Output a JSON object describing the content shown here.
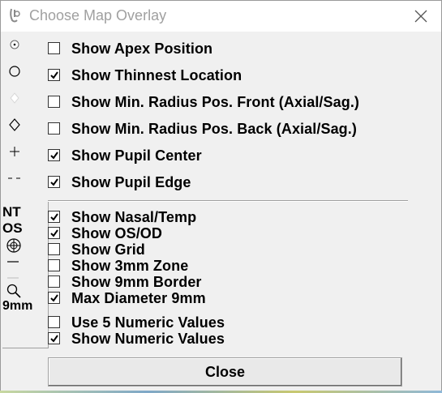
{
  "window": {
    "title": "Choose Map Overlay"
  },
  "groups": {
    "main": [
      {
        "label": "Show Apex Position",
        "checked": false,
        "icon": "dot-circle-icon"
      },
      {
        "label": "Show Thinnest Location",
        "checked": true,
        "icon": "circle-icon"
      },
      {
        "label": "Show Min. Radius Pos. Front (Axial/Sag.)",
        "checked": false,
        "icon": "filled-diamond-icon"
      },
      {
        "label": "Show Min. Radius Pos. Back (Axial/Sag.)",
        "checked": false,
        "icon": "diamond-icon"
      },
      {
        "label": "Show Pupil Center",
        "checked": true,
        "icon": "plus-icon"
      },
      {
        "label": "Show Pupil Edge",
        "checked": true,
        "icon": "dashed-line-icon"
      }
    ],
    "secondary": [
      {
        "label": "Show Nasal/Temp",
        "checked": true
      },
      {
        "label": "Show OS/OD",
        "checked": true
      },
      {
        "label": "Show Grid",
        "checked": false
      },
      {
        "label": "Show 3mm Zone",
        "checked": false
      },
      {
        "label": "Show 9mm Border",
        "checked": false
      },
      {
        "label": "Max Diameter 9mm",
        "checked": true
      }
    ],
    "numeric": [
      {
        "label": "Use 5 Numeric Values",
        "checked": false
      },
      {
        "label": "Show Numeric Values",
        "checked": true
      }
    ]
  },
  "sidebar_text": {
    "nt": "NT",
    "os": "OS",
    "nine_mm": "9mm"
  },
  "buttons": {
    "close": "Close"
  }
}
